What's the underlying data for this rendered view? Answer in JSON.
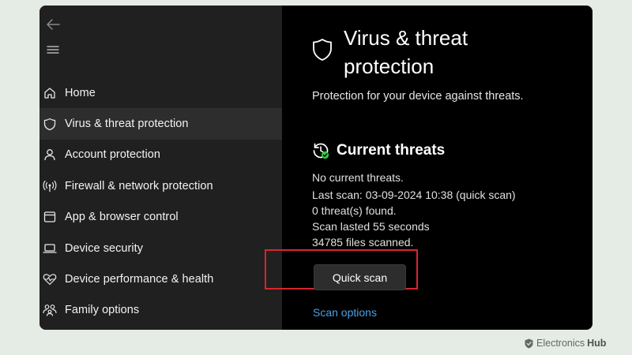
{
  "sidebar": {
    "back_icon": "back-arrow-icon",
    "menu_icon": "hamburger-menu-icon",
    "items": [
      {
        "label": "Home",
        "icon": "home-icon",
        "active": false
      },
      {
        "label": "Virus & threat protection",
        "icon": "shield-icon",
        "active": true
      },
      {
        "label": "Account protection",
        "icon": "person-icon",
        "active": false
      },
      {
        "label": "Firewall & network protection",
        "icon": "antenna-icon",
        "active": false
      },
      {
        "label": "App & browser control",
        "icon": "app-window-icon",
        "active": false
      },
      {
        "label": "Device security",
        "icon": "laptop-icon",
        "active": false
      },
      {
        "label": "Device performance & health",
        "icon": "heart-pulse-icon",
        "active": false
      },
      {
        "label": "Family options",
        "icon": "family-icon",
        "active": false
      }
    ]
  },
  "main": {
    "title": "Virus & threat protection",
    "description": "Protection for your device against threats.",
    "current_threats": {
      "title": "Current threats",
      "status": "No current threats.",
      "last_scan": "Last scan: 03-09-2024 10:38 (quick scan)",
      "threats_found": "0 threat(s) found.",
      "duration": "Scan lasted 55 seconds",
      "files_scanned": "34785 files scanned."
    },
    "quick_scan_label": "Quick scan",
    "scan_options_label": "Scan options"
  },
  "watermark": {
    "brand_light": "Electronics",
    "brand_bold": "Hub"
  },
  "colors": {
    "sidebar_bg": "#202020",
    "main_bg": "#000000",
    "active_item_bg": "#2d2d2d",
    "link": "#4ca0e6",
    "highlight_border": "#d9252b",
    "status_ok": "#2ecc40"
  }
}
